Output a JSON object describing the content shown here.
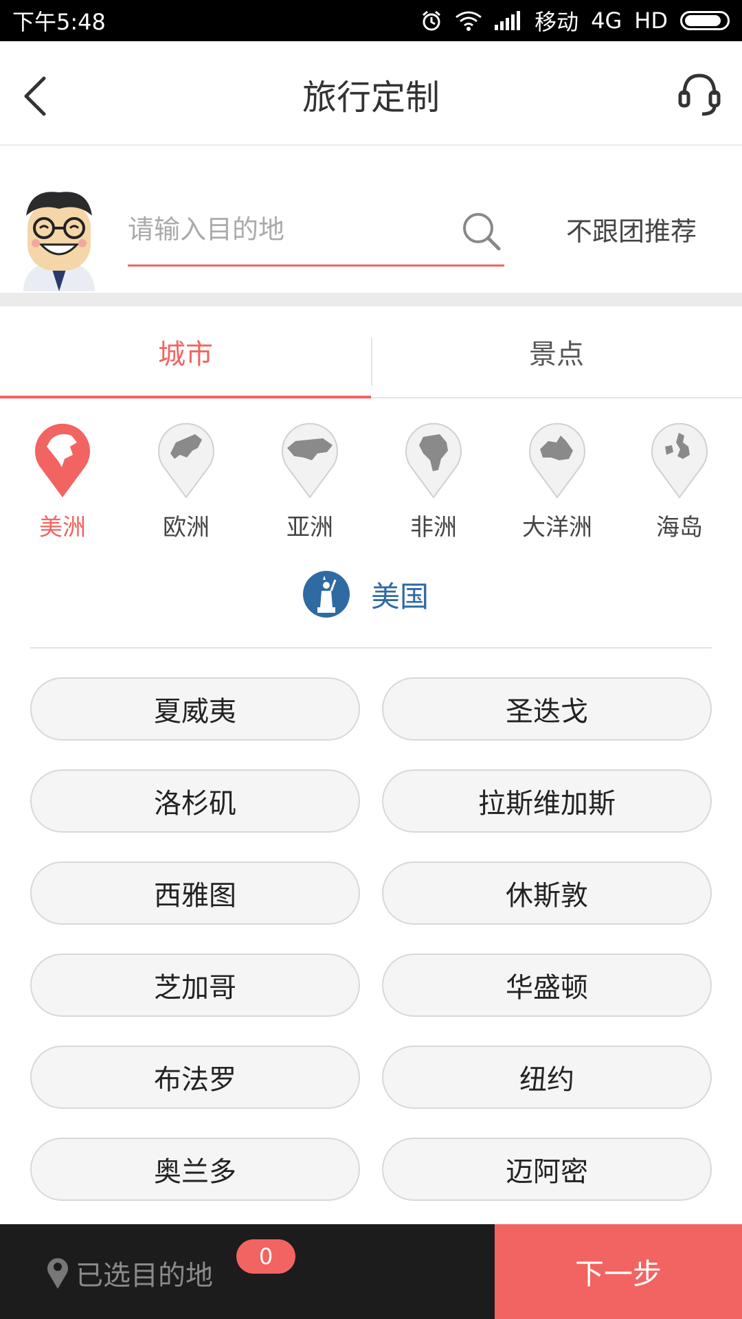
{
  "status_bar": {
    "time": "下午5:48",
    "carrier": "移动",
    "network": "4G",
    "hd": "HD"
  },
  "header": {
    "title": "旅行定制"
  },
  "search": {
    "placeholder": "请输入目的地",
    "value": "",
    "no_group_label": "不跟团推荐"
  },
  "tabs": [
    {
      "label": "城市",
      "active": true
    },
    {
      "label": "景点",
      "active": false
    }
  ],
  "continents": [
    {
      "label": "美洲",
      "active": true,
      "icon": "americas-map-icon"
    },
    {
      "label": "欧洲",
      "active": false,
      "icon": "europe-map-icon"
    },
    {
      "label": "亚洲",
      "active": false,
      "icon": "asia-map-icon"
    },
    {
      "label": "非洲",
      "active": false,
      "icon": "africa-map-icon"
    },
    {
      "label": "大洋洲",
      "active": false,
      "icon": "oceania-map-icon"
    },
    {
      "label": "海岛",
      "active": false,
      "icon": "island-map-icon"
    }
  ],
  "country": {
    "name": "美国",
    "icon": "statue-of-liberty-icon"
  },
  "cities": [
    [
      "夏威夷",
      "圣迭戈"
    ],
    [
      "洛杉矶",
      "拉斯维加斯"
    ],
    [
      "西雅图",
      "休斯敦"
    ],
    [
      "芝加哥",
      "华盛顿"
    ],
    [
      "布法罗",
      "纽约"
    ],
    [
      "奥兰多",
      "迈阿密"
    ]
  ],
  "bottom_bar": {
    "selected_label": "已选目的地",
    "selected_count": "0",
    "next_label": "下一步"
  },
  "colors": {
    "accent": "#f26461",
    "country_blue": "#2f6aa3",
    "bottom_dark": "#1c1c1c"
  }
}
